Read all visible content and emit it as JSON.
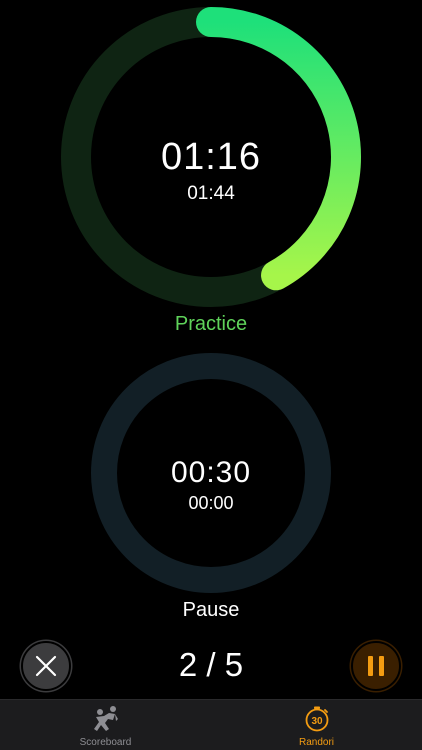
{
  "practice": {
    "elapsed": "01:16",
    "remaining": "01:44",
    "label": "Practice",
    "progress": 0.42,
    "track_color": "#0f2413",
    "gradient_start": "#1ee07a",
    "gradient_end": "#a6f54a"
  },
  "pause": {
    "elapsed": "00:30",
    "remaining": "00:00",
    "label": "Pause",
    "progress": 0,
    "track_color": "#121f26"
  },
  "round": {
    "current": "2 / 5"
  },
  "controls": {
    "cancel_icon": "close-icon",
    "pause_icon": "pause-icon",
    "accent": "#f39c12"
  },
  "tabbar": {
    "tabs": [
      {
        "label": "Scoreboard",
        "icon": "judo-throw-icon",
        "active": false
      },
      {
        "label": "Randori",
        "icon": "timer-30-icon",
        "active": true
      }
    ]
  }
}
